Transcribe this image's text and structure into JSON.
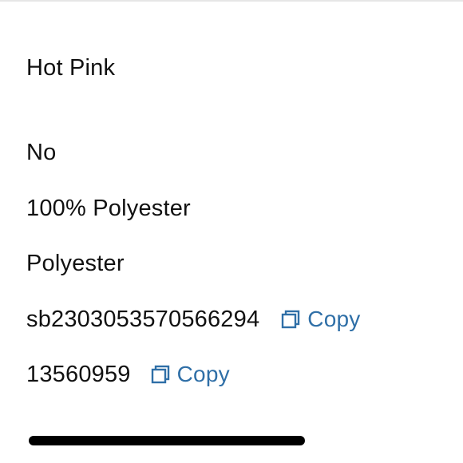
{
  "details": {
    "color": "Hot Pink",
    "option_answer": "No",
    "material": "100% Polyester",
    "fabric": "Polyester",
    "sku": {
      "value": "sb2303053570566294",
      "copy_label": "Copy",
      "copy_icon": "copy-icon"
    },
    "item_number": {
      "value": "13560959",
      "copy_label": "Copy",
      "copy_icon": "copy-icon"
    }
  },
  "colors": {
    "accent": "#2f6fa7",
    "text": "#111111",
    "home_indicator": "#000000"
  }
}
